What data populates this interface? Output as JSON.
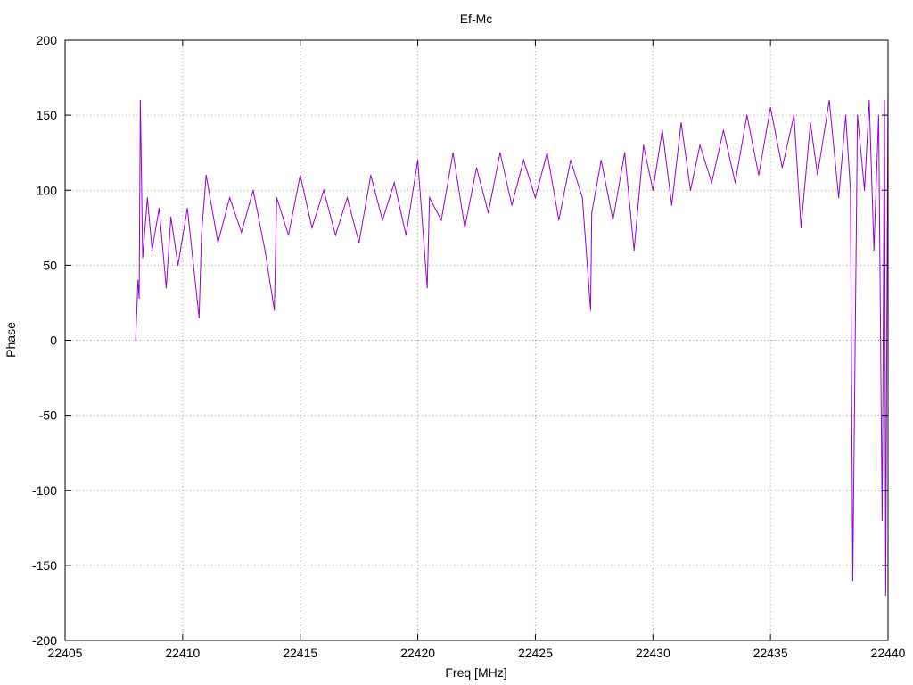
{
  "chart_data": {
    "type": "line",
    "title": "Ef-Mc",
    "xlabel": "Freq [MHz]",
    "ylabel": "Phase",
    "xlim": [
      22405,
      22440
    ],
    "ylim": [
      -200,
      200
    ],
    "xticks": [
      22405,
      22410,
      22415,
      22420,
      22425,
      22430,
      22435,
      22440
    ],
    "yticks": [
      200,
      150,
      100,
      50,
      0,
      -50,
      -100,
      -150,
      -200
    ],
    "grid": true,
    "legend": "none",
    "series": [
      {
        "color": "#9400d3",
        "x": [
          22408.0,
          22408.1,
          22408.15,
          22408.2,
          22408.3,
          22408.5,
          22408.7,
          22409.0,
          22409.3,
          22409.5,
          22409.8,
          22410.2,
          22410.7,
          22410.8,
          22411.0,
          22411.5,
          22412.0,
          22412.5,
          22413.0,
          22413.5,
          22413.9,
          22414.0,
          22414.5,
          22415.0,
          22415.5,
          22416.0,
          22416.5,
          22417.0,
          22417.5,
          22418.0,
          22418.5,
          22419.0,
          22419.5,
          22420.0,
          22420.4,
          22420.5,
          22421.0,
          22421.5,
          22422.0,
          22422.5,
          22423.0,
          22423.5,
          22424.0,
          22424.5,
          22425.0,
          22425.5,
          22426.0,
          22426.5,
          22427.0,
          22427.35,
          22427.4,
          22427.8,
          22428.3,
          22428.8,
          22429.2,
          22429.6,
          22430.0,
          22430.4,
          22430.8,
          22431.2,
          22431.6,
          22432.0,
          22432.5,
          22433.0,
          22433.5,
          22434.0,
          22434.5,
          22435.0,
          22435.5,
          22436.0,
          22436.3,
          22436.7,
          22437.0,
          22437.5,
          22437.9,
          22438.2,
          22438.4,
          22438.5,
          22438.7,
          22439.0,
          22439.2,
          22439.4,
          22439.6,
          22439.75,
          22439.85,
          22439.9,
          22439.95,
          22440.0
        ],
        "values": [
          0,
          40,
          28,
          160,
          55,
          95,
          60,
          88,
          35,
          82,
          50,
          88,
          15,
          70,
          110,
          65,
          95,
          72,
          100,
          60,
          20,
          95,
          70,
          110,
          75,
          100,
          70,
          95,
          65,
          110,
          80,
          105,
          70,
          120,
          35,
          95,
          80,
          125,
          75,
          115,
          85,
          125,
          90,
          120,
          95,
          125,
          80,
          120,
          95,
          20,
          85,
          120,
          80,
          125,
          60,
          130,
          100,
          140,
          90,
          145,
          100,
          130,
          105,
          140,
          105,
          150,
          110,
          155,
          115,
          150,
          75,
          145,
          110,
          160,
          95,
          150,
          100,
          -160,
          150,
          100,
          160,
          60,
          150,
          -120,
          160,
          -170,
          10,
          170
        ]
      }
    ]
  }
}
